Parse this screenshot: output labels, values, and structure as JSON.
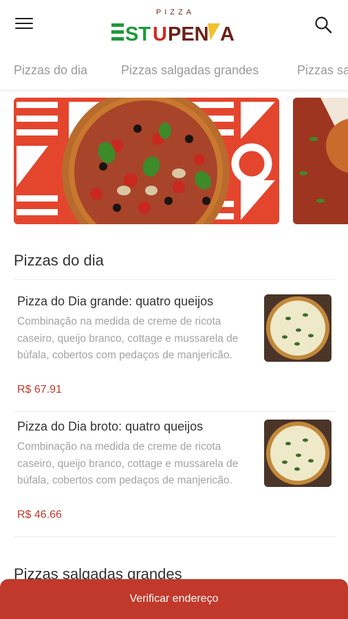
{
  "brand": {
    "top_text": "PIZZA",
    "logo_text": "ESTUPENDA",
    "colors": {
      "green": "#1e9a3a",
      "red": "#d6281f",
      "yellow": "#f2c12e",
      "brown": "#6b2218"
    }
  },
  "header": {
    "menu_icon": "hamburger-icon",
    "search_icon": "search-icon"
  },
  "tabs": [
    {
      "label": "Pizzas do dia"
    },
    {
      "label": "Pizzas salgadas grandes"
    },
    {
      "label": "Pizzas salgadas broto"
    }
  ],
  "sections": [
    {
      "title": "Pizzas do dia",
      "items": [
        {
          "name": "Pizza do Dia grande: quatro queijos",
          "description": "Combinação na medida de creme de ricota caseiro, queijo branco, cottage e mussarela de búfala, cobertos com pedaços de manjericão.",
          "price": "R$ 67.91"
        },
        {
          "name": "Pizza do Dia broto: quatro queijos",
          "description": "Combinação na medida de creme de ricota caseiro, queijo branco, cottage e mussarela de búfala, cobertos com pedaços de manjericão.",
          "price": "R$ 46.66"
        }
      ]
    },
    {
      "title": "Pizzas salgadas grandes"
    }
  ],
  "cta": {
    "label": "Verificar endereço"
  },
  "theme": {
    "accent": "#c0392b",
    "banner_bg": "#e4452d"
  }
}
